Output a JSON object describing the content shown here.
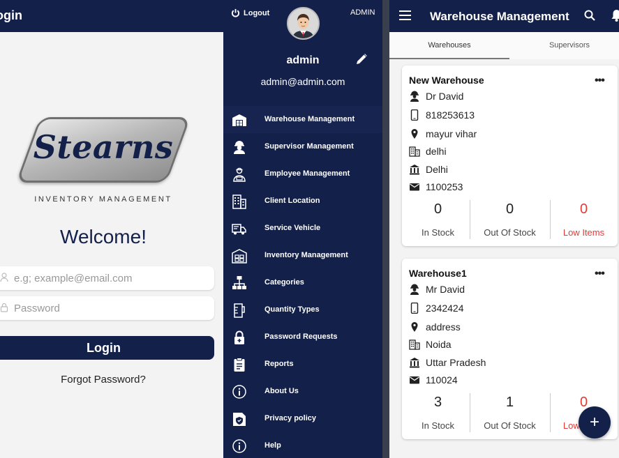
{
  "login": {
    "bar_title": "ogin",
    "logo_text": "Stearns",
    "logo_sub": "INVENTORY MANAGEMENT",
    "welcome": "Welcome!",
    "email_placeholder": "e.g; example@email.com",
    "password_placeholder": "Password",
    "login_button": "Login",
    "forgot_link": "Forgot Password?"
  },
  "drawer": {
    "logout_label": "Logout",
    "role": "ADMIN",
    "user_name": "admin",
    "user_email": "admin@admin.com",
    "items": [
      {
        "label": "Warehouse Management",
        "icon": "warehouse-icon"
      },
      {
        "label": "Supervisor Management",
        "icon": "supervisor-icon"
      },
      {
        "label": "Employee Management",
        "icon": "employee-icon"
      },
      {
        "label": "Client Location",
        "icon": "building-icon"
      },
      {
        "label": "Service Vehicle",
        "icon": "truck-icon"
      },
      {
        "label": "Inventory Management",
        "icon": "inventory-icon"
      },
      {
        "label": "Categories",
        "icon": "hierarchy-icon"
      },
      {
        "label": "Quantity Types",
        "icon": "measuring-cup-icon"
      },
      {
        "label": "Password Requests",
        "icon": "lock-icon"
      },
      {
        "label": "Reports",
        "icon": "clipboard-icon"
      },
      {
        "label": "About Us",
        "icon": "info-icon"
      },
      {
        "label": "Privacy policy",
        "icon": "shield-doc-icon"
      },
      {
        "label": "Help",
        "icon": "info-icon"
      }
    ]
  },
  "warehouse": {
    "title": "Warehouse Management",
    "tabs": [
      "Warehouses",
      "Supervisors"
    ],
    "cards": [
      {
        "name": "New Warehouse",
        "supervisor": "Dr David",
        "phone": "818253613",
        "address": "mayur vihar",
        "city": "delhi",
        "state": "Delhi",
        "pincode": "1100253",
        "in_stock": "0",
        "out_of_stock": "0",
        "low_items": "0",
        "in_stock_label": "In Stock",
        "out_of_stock_label": "Out Of Stock",
        "low_items_label": "Low Items"
      },
      {
        "name": "Warehouse1",
        "supervisor": "Mr David",
        "phone": "2342424",
        "address": "address",
        "city": "Noida",
        "state": "Uttar Pradesh",
        "pincode": "110024",
        "in_stock": "3",
        "out_of_stock": "1",
        "low_items": "0",
        "in_stock_label": "In Stock",
        "out_of_stock_label": "Out Of Stock",
        "low_items_label": "Low Items"
      }
    ],
    "fab_label": "+"
  },
  "colors": {
    "navy": "#13204a",
    "alert_red": "#e53935"
  }
}
